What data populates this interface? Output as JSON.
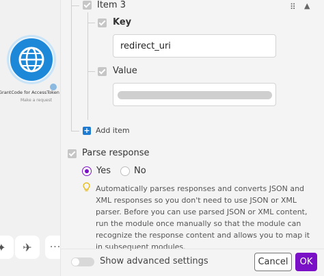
{
  "canvas": {
    "module_title": "GrantCode for AccessToken & Refr",
    "module_subtitle": "Make a request",
    "more_label": "···"
  },
  "item": {
    "title": "Item 3",
    "key_label": "Key",
    "key_value": "redirect_uri",
    "value_label": "Value",
    "add_item_label": "Add item"
  },
  "parse_response": {
    "label": "Parse response",
    "options": [
      "Yes",
      "No"
    ],
    "selected": "Yes",
    "help": "Automatically parses responses and converts JSON and XML responses so you don't need to use JSON or XML parser. Before you can use parsed JSON or XML content, run the module once manually so that the module can recognize the response content and allows you to map it in subsequent modules."
  },
  "footer": {
    "advanced_label": "Show advanced settings",
    "cancel_label": "Cancel",
    "ok_label": "OK"
  },
  "colors": {
    "accent": "#7a11c7",
    "module": "#1e88d8",
    "add": "#1f7bd0"
  }
}
